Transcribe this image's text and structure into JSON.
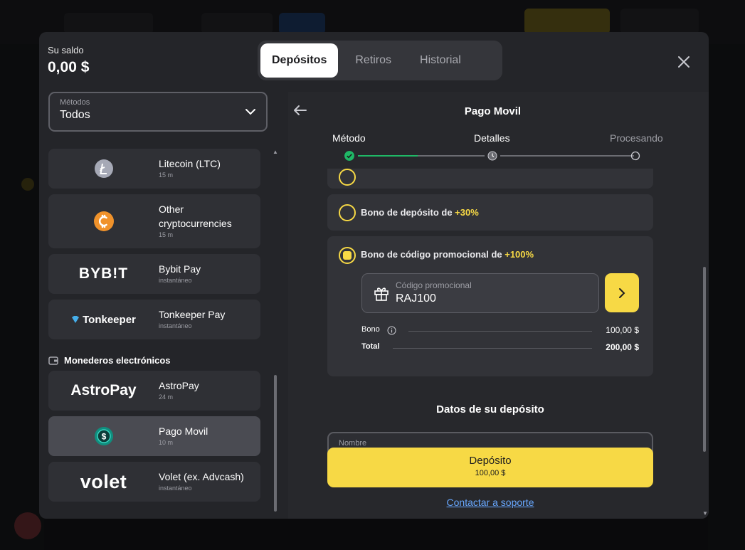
{
  "balance": {
    "label": "Su saldo",
    "value": "0,00 $"
  },
  "tabs": [
    {
      "label": "Depósitos",
      "active": true
    },
    {
      "label": "Retiros",
      "active": false
    },
    {
      "label": "Historial",
      "active": false
    }
  ],
  "methods": {
    "label": "Métodos",
    "value": "Todos"
  },
  "payment_methods": [
    {
      "name": "Litecoin (LTC)",
      "time": "15 m"
    },
    {
      "name": "Other cryptocurrencies",
      "time": "15 m"
    },
    {
      "name": "Bybit Pay",
      "time": "instantáneo",
      "logo": "BYB!T"
    },
    {
      "name": "Tonkeeper Pay",
      "time": "instantáneo",
      "logo": "Tonkeeper"
    },
    {
      "name": "AstroPay",
      "time": "24 m",
      "logo": "AstroPay"
    },
    {
      "name": "Pago Movil",
      "time": "10 m",
      "selected": true
    },
    {
      "name": "Volet (ex. Advcash)",
      "time": "instantáneo",
      "logo": "volet"
    }
  ],
  "ewallets_section": "Monederos electrónicos",
  "details": {
    "title": "Pago Movil",
    "steps": [
      {
        "label": "Método",
        "state": "done"
      },
      {
        "label": "Detalles",
        "state": "current"
      },
      {
        "label": "Procesando",
        "state": "pending"
      }
    ],
    "bonus_deposit": {
      "text": "Bono de depósito de ",
      "highlight": "+30%"
    },
    "bonus_promo": {
      "text": "Bono de código promocional de ",
      "highlight": "+100%"
    },
    "promo": {
      "label": "Código promocional",
      "value": "RAJ100"
    },
    "summary": [
      {
        "label": "Bono",
        "value": "100,00 $"
      },
      {
        "label": "Total",
        "value": "200,00 $"
      }
    ],
    "deposit_section_title": "Datos de su depósito",
    "name_field_label": "Nombre"
  },
  "deposit_button": {
    "label": "Depósito",
    "amount": "100,00 $"
  },
  "support_link": "Contactar a soporte",
  "colors": {
    "accent": "#f7d945",
    "success": "#1fb866",
    "link": "#68a8ff",
    "panel": "#242529"
  }
}
